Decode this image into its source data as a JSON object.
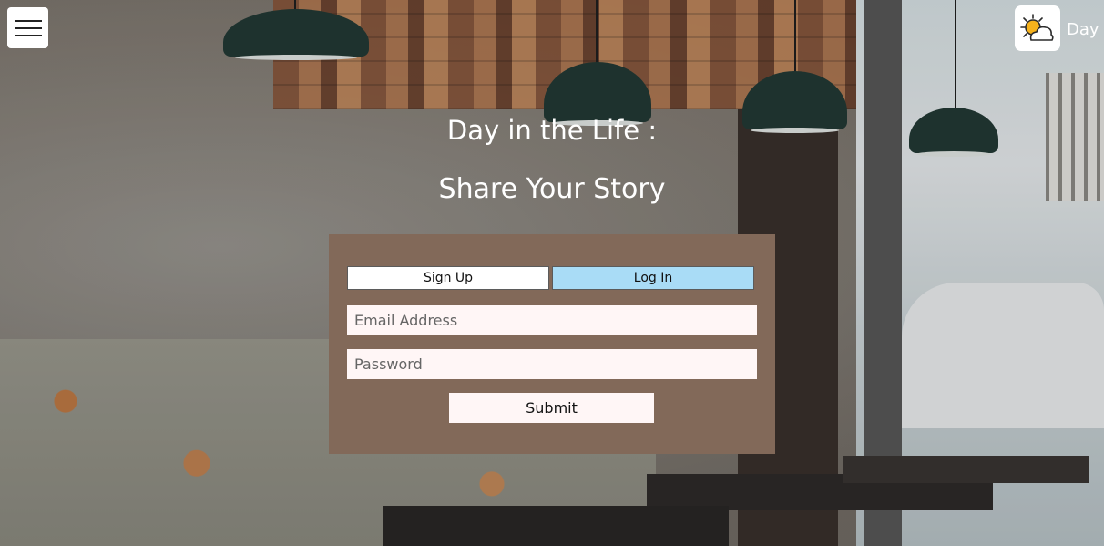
{
  "header": {
    "menu_icon": "hamburger-menu-icon",
    "weather_icon": "partly-cloudy-sun-icon",
    "weather_label": "Day"
  },
  "hero": {
    "title_line1": "Day in the Life :",
    "title_line2": "Share Your Story"
  },
  "auth": {
    "tabs": [
      {
        "label": "Sign Up",
        "active": false
      },
      {
        "label": "Log In",
        "active": true
      }
    ],
    "email_placeholder": "Email Address",
    "password_placeholder": "Password",
    "submit_label": "Submit"
  },
  "colors": {
    "panel_bg": "#826959",
    "active_tab": "#a9dcf6",
    "field_bg": "#fff6f6"
  }
}
